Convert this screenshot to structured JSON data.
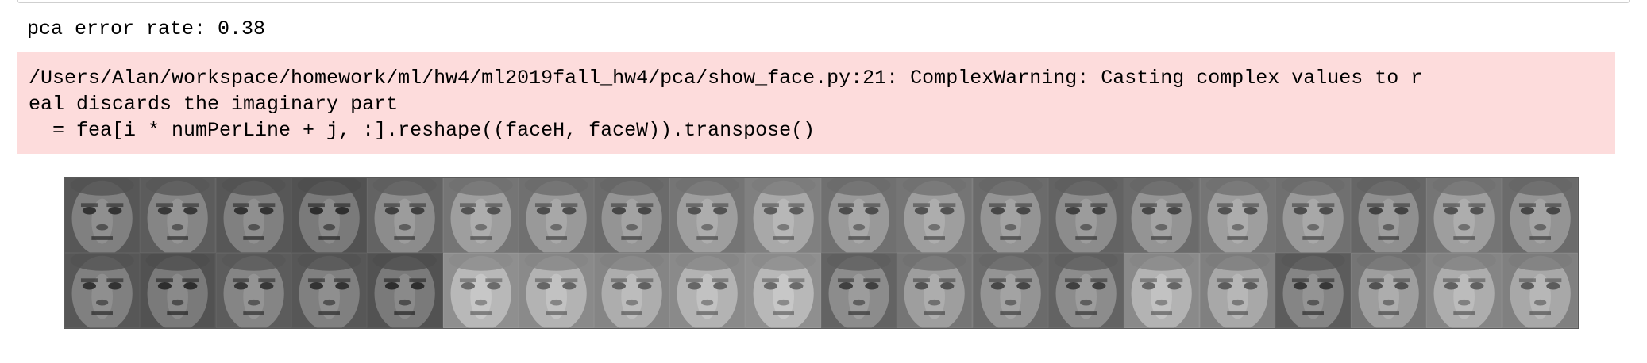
{
  "output": {
    "stdout_text": "pca error rate: 0.38",
    "stderr_lines": [
      "/Users/Alan/workspace/homework/ml/hw4/ml2019fall_hw4/pca/show_face.py:21: ComplexWarning: Casting complex values to r",
      "eal discards the imaginary part",
      "  = fea[i * numPerLine + j, :].reshape((faceH, faceW)).transpose()"
    ],
    "stderr_background": "#fddcdc"
  },
  "faces_figure": {
    "rows": 2,
    "columns": 20,
    "row_tones": [
      [
        0.5,
        0.52,
        0.5,
        0.48,
        0.55,
        0.62,
        0.6,
        0.58,
        0.62,
        0.66,
        0.6,
        0.62,
        0.58,
        0.55,
        0.58,
        0.62,
        0.6,
        0.56,
        0.62,
        0.58
      ],
      [
        0.5,
        0.48,
        0.52,
        0.5,
        0.48,
        0.72,
        0.7,
        0.68,
        0.7,
        0.72,
        0.55,
        0.62,
        0.58,
        0.55,
        0.7,
        0.66,
        0.52,
        0.62,
        0.68,
        0.66
      ]
    ]
  }
}
